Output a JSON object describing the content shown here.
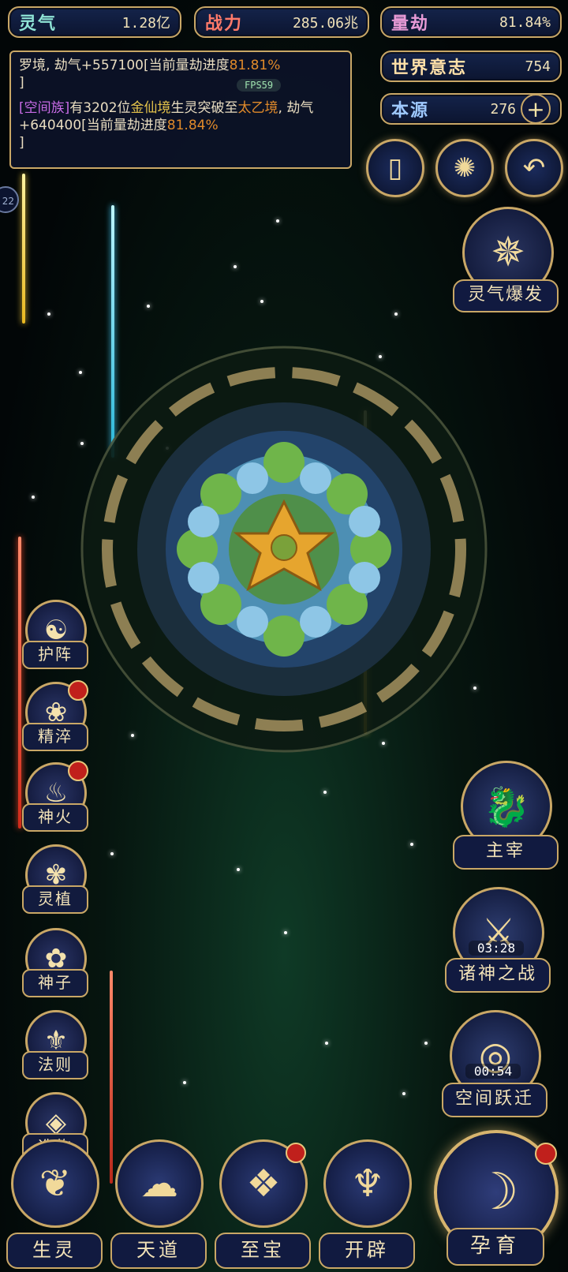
{
  "resources": {
    "lingqi": {
      "label": "灵气",
      "value": "1.28亿"
    },
    "zhanli": {
      "label": "战力",
      "value": "285.06兆"
    },
    "liangjie": {
      "label": "量劫",
      "value": "81.84%"
    },
    "shijie": {
      "label": "世界意志",
      "value": "754"
    },
    "benyuan": {
      "label": "本源",
      "value": "276"
    }
  },
  "log": {
    "line1_a": "罗境, 劫气+557100[当前量劫进度",
    "line1_pct": "81.81%",
    "line1_end": "]",
    "line2_a": "[空间族]",
    "line2_b": "有3202位",
    "line2_c": "金仙境",
    "line2_d": "生灵突破至",
    "line2_e": "太乙境",
    "line2_f": ", 劫气+640400[当前量劫进度",
    "line2_pct": "81.84%",
    "line2_end": "]"
  },
  "fps": "FPS59",
  "left_badge": "22",
  "right_menu": {
    "burst": "灵气爆发"
  },
  "side_menu": [
    "护阵",
    "精淬",
    "神火",
    "灵植",
    "神子",
    "法则",
    "造物"
  ],
  "right_panel": {
    "zhuzai": "主宰",
    "zhushen": "诸神之战",
    "zhushen_timer": "03:28",
    "kongjian": "空间跃迁",
    "kongjian_timer": "00:54"
  },
  "bottom_menu": [
    "生灵",
    "天道",
    "至宝",
    "开辟",
    "孕育"
  ],
  "colors": {
    "gold": "#c9a766",
    "panel": "#111a40",
    "alert": "#c0201c"
  }
}
